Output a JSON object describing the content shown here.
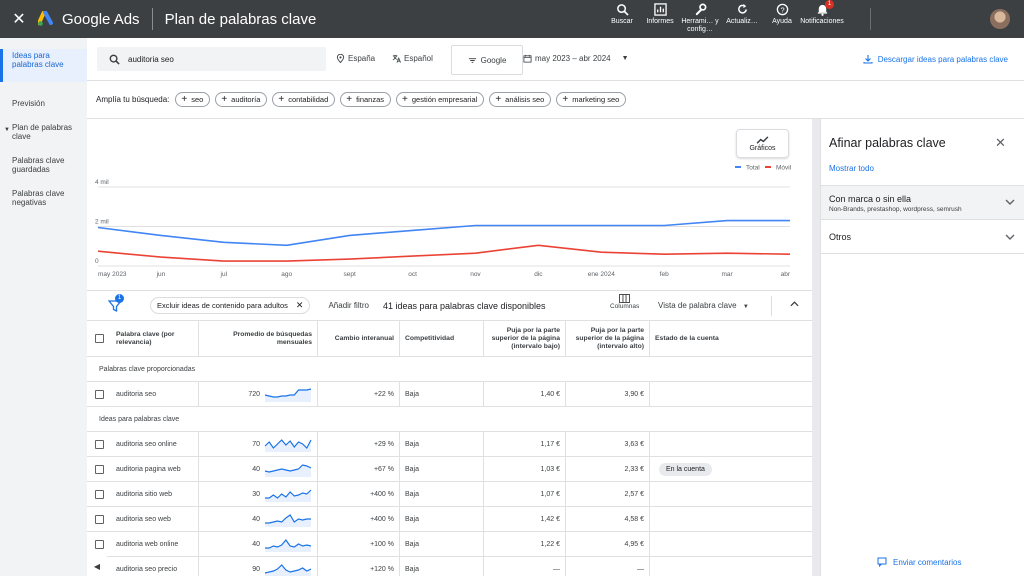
{
  "topbar": {
    "brand": "Google Ads",
    "page_title": "Plan de palabras clave",
    "tools": [
      {
        "icon": "search-icon",
        "label": "Buscar"
      },
      {
        "icon": "reports-icon",
        "label": "Informes"
      },
      {
        "icon": "wrench-icon",
        "label": "Herrami… y config…"
      },
      {
        "icon": "refresh-icon",
        "label": "Actualiz…"
      },
      {
        "icon": "help-icon",
        "label": "Ayuda"
      },
      {
        "icon": "bell-icon",
        "label": "Notificaciones"
      }
    ],
    "notif_badge": "1"
  },
  "leftnav": {
    "items": [
      {
        "label": "Ideas para palabras clave",
        "active": true
      },
      {
        "label": "Previsión"
      },
      {
        "label": "Plan de palabras clave"
      },
      {
        "label": "Palabras clave guardadas"
      },
      {
        "label": "Palabras clave negativas"
      }
    ]
  },
  "search": {
    "query": "auditoria seo",
    "location": "España",
    "language": "Español",
    "network": "Google",
    "date_range": "may 2023 – abr 2024",
    "download_label": "Descargar ideas para palabras clave"
  },
  "broaden": {
    "label": "Amplía tu búsqueda:",
    "chips": [
      "seo",
      "auditoría",
      "contabilidad",
      "finanzas",
      "gestión empresarial",
      "análisis seo",
      "marketing seo"
    ]
  },
  "chart_data": {
    "type": "line",
    "x": [
      "may 2023",
      "jun",
      "jul",
      "ago",
      "sept",
      "oct",
      "nov",
      "dic",
      "ene 2024",
      "feb",
      "mar",
      "abr"
    ],
    "y_ticks": [
      "0",
      "2 mil",
      "4 mil"
    ],
    "ylim": [
      0,
      4000
    ],
    "grid": true,
    "legend_position": "top-right",
    "button_label": "Gráficos",
    "series": [
      {
        "name": "Total",
        "color": "#4285f4",
        "values": [
          1950,
          1550,
          1200,
          1050,
          1550,
          1800,
          2050,
          2050,
          2050,
          2050,
          2300,
          2300
        ]
      },
      {
        "name": "Móvil",
        "color": "#ea4335",
        "values": [
          750,
          450,
          250,
          250,
          350,
          500,
          650,
          1050,
          700,
          600,
          650,
          600
        ]
      }
    ]
  },
  "toolbar": {
    "filter_badge": "1",
    "exclude_chip": "Excluir ideas de contenido para adultos",
    "add_filter": "Añadir filtro",
    "ideas_count": "41 ideas para palabras clave disponibles",
    "columns_label": "Columnas",
    "view_label": "Vista de palabra clave"
  },
  "table": {
    "headers": {
      "keyword": "Palabra clave (por relevancia)",
      "avg": "Promedio de búsquedas mensuales",
      "change": "Cambio interanual",
      "competition": "Competitividad",
      "bid_low": "Puja por la parte superior de la página (intervalo bajo)",
      "bid_high": "Puja por la parte superior de la página (intervalo alto)",
      "state": "Estado de la cuenta"
    },
    "section_provided": "Palabras clave proporcionadas",
    "section_ideas": "Ideas para palabras clave",
    "provided_rows": [
      {
        "keyword": "auditoria seo",
        "avg": "720",
        "change": "+22 %",
        "competition": "Baja",
        "bid_low": "1,40 €",
        "bid_high": "3,90 €",
        "state": "",
        "spark": [
          9,
          10,
          11,
          11,
          10,
          10,
          9,
          9,
          4,
          4,
          4,
          3
        ]
      }
    ],
    "idea_rows": [
      {
        "keyword": "auditoria seo online",
        "avg": "70",
        "change": "+29 %",
        "competition": "Baja",
        "bid_low": "1,17 €",
        "bid_high": "3,63 €",
        "state": "",
        "spark": [
          10,
          6,
          12,
          8,
          4,
          9,
          5,
          11,
          6,
          8,
          12,
          4
        ]
      },
      {
        "keyword": "auditoria pagina web",
        "avg": "40",
        "change": "+67 %",
        "competition": "Baja",
        "bid_low": "1,03 €",
        "bid_high": "2,33 €",
        "state": "En la cuenta",
        "spark": [
          10,
          11,
          10,
          9,
          8,
          9,
          10,
          9,
          8,
          4,
          5,
          7
        ]
      },
      {
        "keyword": "auditoria sitio web",
        "avg": "30",
        "change": "+400 %",
        "competition": "Baja",
        "bid_low": "1,07 €",
        "bid_high": "2,57 €",
        "state": "",
        "spark": [
          12,
          12,
          9,
          12,
          8,
          11,
          6,
          10,
          9,
          7,
          8,
          4
        ]
      },
      {
        "keyword": "auditoria seo web",
        "avg": "40",
        "change": "+400 %",
        "competition": "Baja",
        "bid_low": "1,42 €",
        "bid_high": "4,58 €",
        "state": "",
        "spark": [
          12,
          12,
          11,
          10,
          11,
          7,
          4,
          11,
          8,
          9,
          8,
          8
        ]
      },
      {
        "keyword": "auditoria web online",
        "avg": "40",
        "change": "+100 %",
        "competition": "Baja",
        "bid_low": "1,22 €",
        "bid_high": "4,95 €",
        "state": "",
        "spark": [
          12,
          12,
          10,
          11,
          9,
          4,
          10,
          11,
          8,
          10,
          9,
          10
        ]
      },
      {
        "keyword": "auditoria seo precio",
        "avg": "90",
        "change": "+120 %",
        "competition": "Baja",
        "bid_low": "—",
        "bid_high": "—",
        "state": "",
        "spark": [
          12,
          11,
          10,
          8,
          4,
          9,
          11,
          10,
          9,
          7,
          10,
          8
        ]
      }
    ]
  },
  "rightpanel": {
    "title": "Afinar palabras clave",
    "show_all": "Mostrar todo",
    "sections": [
      {
        "title": "Con marca o sin ella",
        "subtitle": "Non-Brands, prestashop, wordpress, semrush"
      },
      {
        "title": "Otros",
        "subtitle": ""
      }
    ],
    "feedback": "Enviar comentarios"
  },
  "colors": {
    "accent": "#1a73e8",
    "topbar": "#3c4043",
    "total_line": "#4285f4",
    "mobile_line": "#ea4335"
  }
}
